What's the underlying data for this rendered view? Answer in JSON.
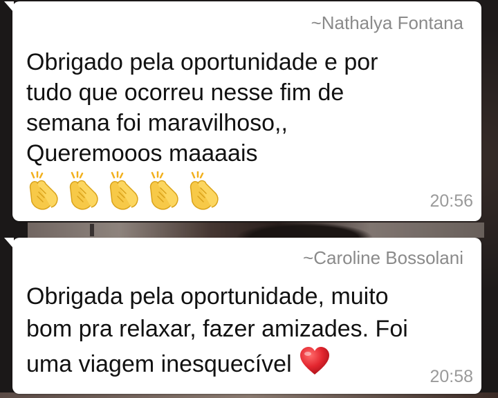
{
  "messages": [
    {
      "sender": "~Nathalya Fontana",
      "lines": [
        "Obrigado pela oportunidade e por",
        "tudo que ocorreu nesse fim de",
        "semana foi maravilhoso,,",
        "Queremooos maaaais"
      ],
      "emoji": [
        "clapping-hands-icon",
        "clapping-hands-icon",
        "clapping-hands-icon",
        "clapping-hands-icon",
        "clapping-hands-icon"
      ],
      "time": "20:56"
    },
    {
      "sender": "~Caroline Bossolani",
      "lines": [
        "Obrigada pela oportunidade, muito",
        "bom pra relaxar, fazer amizades. Foi",
        "uma viagem inesquecível"
      ],
      "emoji": [
        "red-heart-icon"
      ],
      "time": "20:58"
    }
  ],
  "colors": {
    "bubble": "#ffffff",
    "sender": "#8a8a8a",
    "text": "#111111",
    "time": "#9a9a9a",
    "clap": "#f7c948",
    "heart": "#e3262f"
  }
}
